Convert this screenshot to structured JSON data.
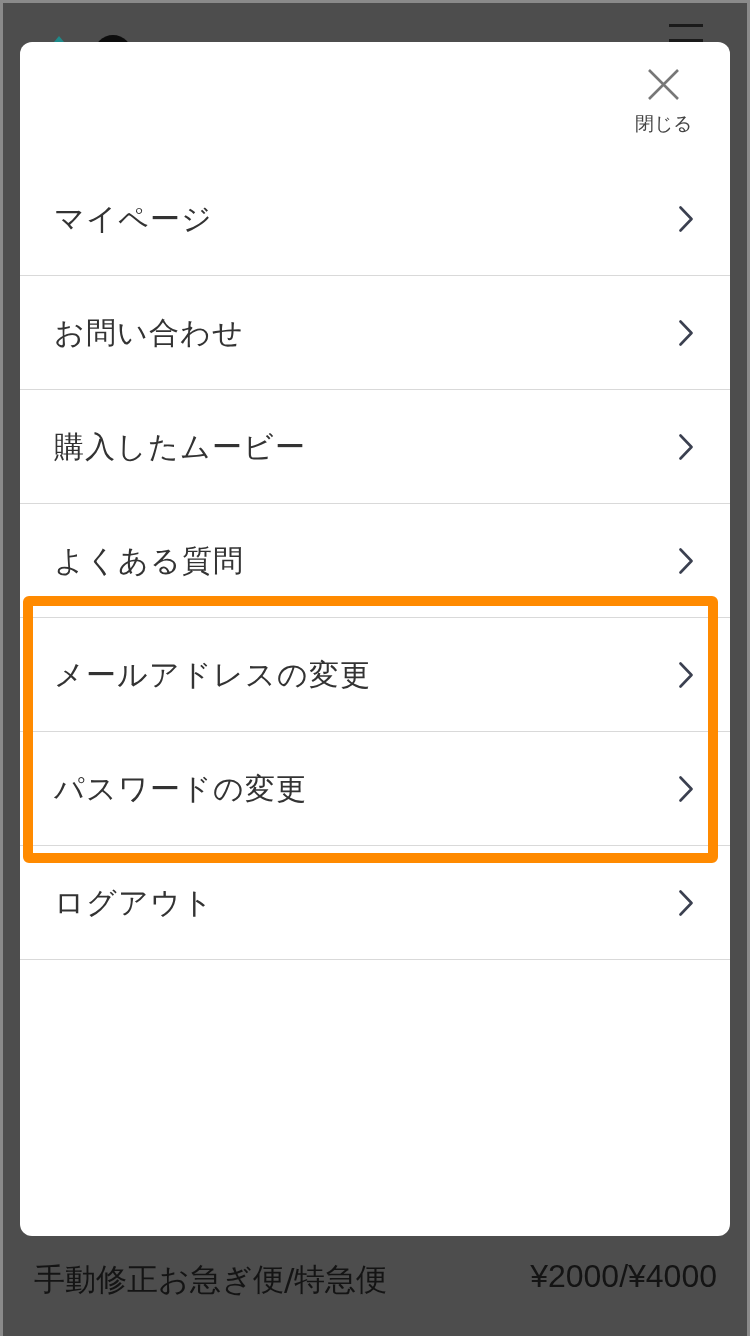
{
  "modal": {
    "close_label": "閉じる",
    "items": [
      {
        "label": "マイページ",
        "highlighted": false
      },
      {
        "label": "お問い合わせ",
        "highlighted": false
      },
      {
        "label": "購入したムービー",
        "highlighted": false
      },
      {
        "label": "よくある質問",
        "highlighted": false
      },
      {
        "label": "メールアドレスの変更",
        "highlighted": true
      },
      {
        "label": "パスワードの変更",
        "highlighted": true
      },
      {
        "label": "ログアウト",
        "highlighted": false
      }
    ]
  },
  "background_page": {
    "title": "手動修正お急ぎ便/特急便",
    "price": "¥2000/¥4000"
  }
}
